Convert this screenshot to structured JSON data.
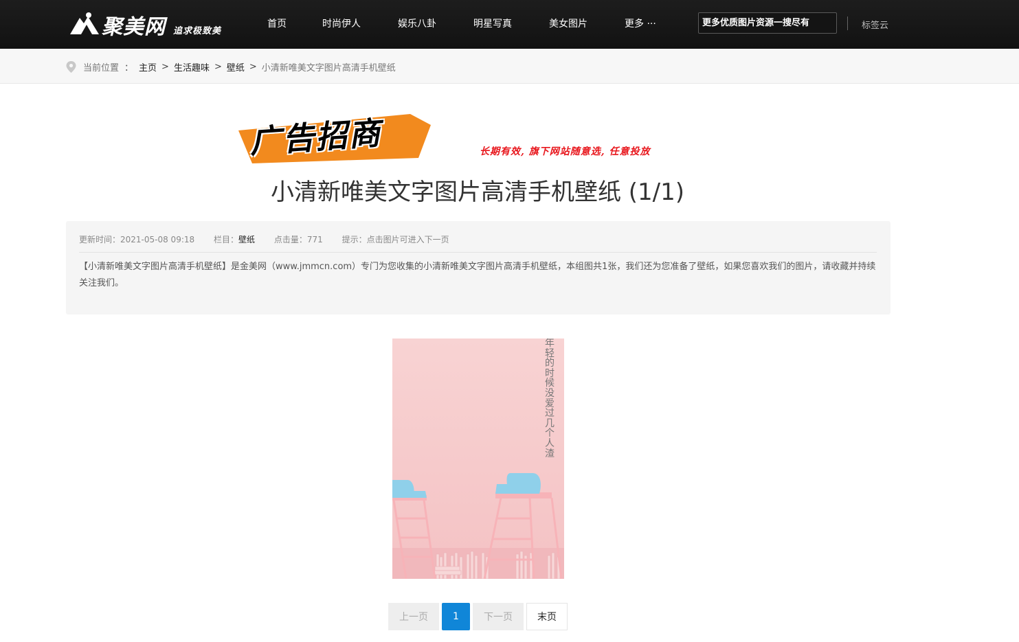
{
  "header": {
    "logo_name": "聚美网",
    "logo_slogan": "追求极致美",
    "nav": [
      "首页",
      "时尚伊人",
      "娱乐八卦",
      "明星写真",
      "美女图片",
      "更多 ···"
    ],
    "search_placeholder": "更多优质图片资源一搜尽有",
    "tag_cloud": "标签云"
  },
  "breadcrumb": {
    "label": "当前位置",
    "colon": "：",
    "sep": ">",
    "items": [
      "主页",
      "生活趣味",
      "壁纸"
    ],
    "current": "小清新唯美文字图片高清手机壁纸"
  },
  "ad": {
    "badge_text": "广告招商",
    "tagline": "长期有效, 旗下网站随意选, 任意投放",
    "badge_color": "#f28a1e"
  },
  "article": {
    "title": "小清新唯美文字图片高清手机壁纸 (1/1)",
    "meta": {
      "updated": "更新时间：2021-05-08 09:18",
      "column_label": "栏目：",
      "column_value": "壁纸",
      "views": "点击量：771",
      "tip": "提示：点击图片可进入下一页"
    },
    "description": "【小清新唯美文字图片高清手机壁纸】是金美网（www.jmmcn.com）专门为您收集的小清新唯美文字图片高清手机壁纸，本组图共1张，我们还为您准备了壁纸，如果您喜欢我们的图片，请收藏并持续关注我们。",
    "image_text": "年轻的时候没爱过几个人渣"
  },
  "pagination": {
    "prev": "上一页",
    "current": "1",
    "next": "下一页",
    "last": "末页"
  },
  "colors": {
    "header_bg": "#161616",
    "accent": "#1086d8",
    "ad_red": "#e8161c",
    "photo_pink": "#f6cccd",
    "chair_blue": "#8fd0ea"
  }
}
